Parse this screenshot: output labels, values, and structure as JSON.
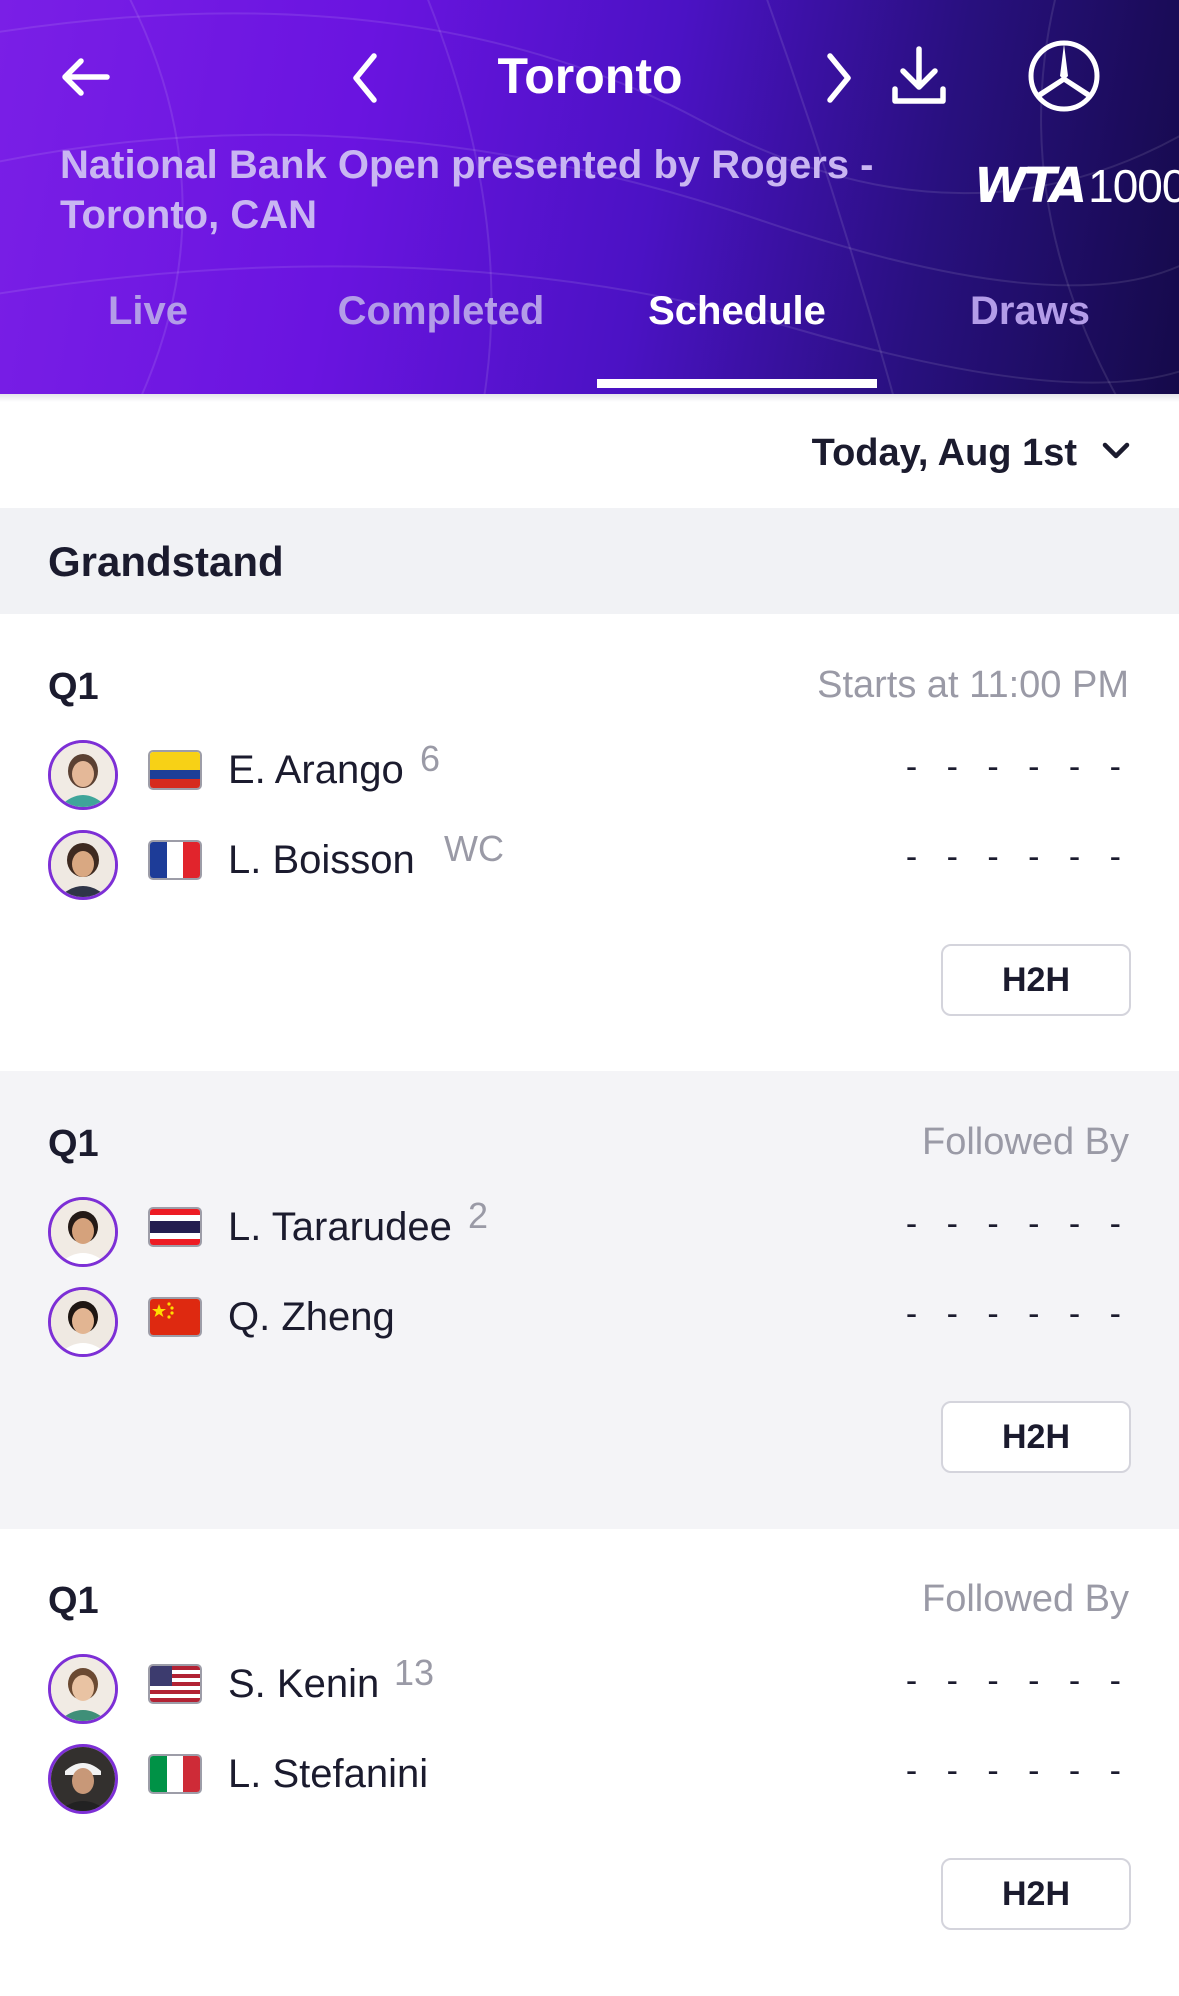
{
  "header": {
    "title": "Toronto",
    "subtitle_line1": "National Bank Open presented by Rogers -",
    "subtitle_line2": "Toronto, CAN",
    "brand_wta": "WTA",
    "brand_tier": "1000",
    "icons": [
      "back-arrow-icon",
      "chevron-left-icon",
      "chevron-right-icon",
      "download-icon",
      "mercedes-logo-icon"
    ]
  },
  "tabs": [
    {
      "label": "Live",
      "active": false
    },
    {
      "label": "Completed",
      "active": false
    },
    {
      "label": "Schedule",
      "active": true
    },
    {
      "label": "Draws",
      "active": false
    }
  ],
  "date_picker": {
    "label": "Today, Aug 1st"
  },
  "court": {
    "name": "Grandstand"
  },
  "matches": [
    {
      "round": "Q1",
      "status": "Starts at 11:00 PM",
      "players": [
        {
          "name": "E. Arango",
          "seed": "6",
          "flag": "Colombia",
          "score": "- - - - - -"
        },
        {
          "name": "L. Boisson",
          "seed": "WC",
          "flag": "France",
          "score": "- - - - - -"
        }
      ],
      "h2h_label": "H2H"
    },
    {
      "round": "Q1",
      "status": "Followed By",
      "players": [
        {
          "name": "L. Tararudee",
          "seed": "2",
          "flag": "Thailand",
          "score": "- - - - - -"
        },
        {
          "name": "Q. Zheng",
          "seed": "",
          "flag": "China",
          "score": "- - - - - -"
        }
      ],
      "h2h_label": "H2H"
    },
    {
      "round": "Q1",
      "status": "Followed By",
      "players": [
        {
          "name": "S. Kenin",
          "seed": "13",
          "flag": "USA",
          "score": "- - - - - -"
        },
        {
          "name": "L. Stefanini",
          "seed": "",
          "flag": "Italy",
          "score": "- - - - - -"
        }
      ],
      "h2h_label": "H2H"
    }
  ],
  "colors": {
    "header_start": "#7a1fe6",
    "header_end": "#150a4a",
    "avatar_ring": "#7d2fd6",
    "muted_text": "#9a9aa6"
  }
}
